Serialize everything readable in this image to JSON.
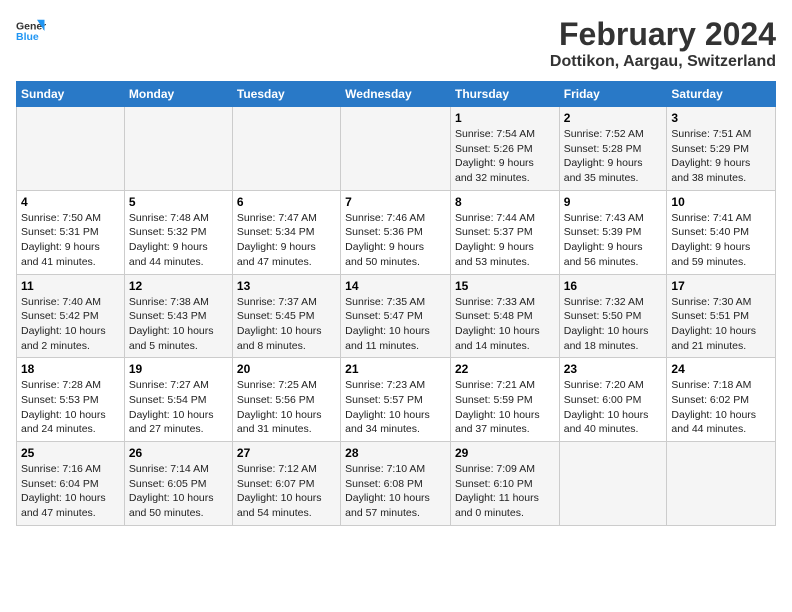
{
  "header": {
    "logo_line1": "General",
    "logo_line2": "Blue",
    "month": "February 2024",
    "location": "Dottikon, Aargau, Switzerland"
  },
  "columns": [
    "Sunday",
    "Monday",
    "Tuesday",
    "Wednesday",
    "Thursday",
    "Friday",
    "Saturday"
  ],
  "weeks": [
    [
      {
        "day": "",
        "info": ""
      },
      {
        "day": "",
        "info": ""
      },
      {
        "day": "",
        "info": ""
      },
      {
        "day": "",
        "info": ""
      },
      {
        "day": "1",
        "info": "Sunrise: 7:54 AM\nSunset: 5:26 PM\nDaylight: 9 hours\nand 32 minutes."
      },
      {
        "day": "2",
        "info": "Sunrise: 7:52 AM\nSunset: 5:28 PM\nDaylight: 9 hours\nand 35 minutes."
      },
      {
        "day": "3",
        "info": "Sunrise: 7:51 AM\nSunset: 5:29 PM\nDaylight: 9 hours\nand 38 minutes."
      }
    ],
    [
      {
        "day": "4",
        "info": "Sunrise: 7:50 AM\nSunset: 5:31 PM\nDaylight: 9 hours\nand 41 minutes."
      },
      {
        "day": "5",
        "info": "Sunrise: 7:48 AM\nSunset: 5:32 PM\nDaylight: 9 hours\nand 44 minutes."
      },
      {
        "day": "6",
        "info": "Sunrise: 7:47 AM\nSunset: 5:34 PM\nDaylight: 9 hours\nand 47 minutes."
      },
      {
        "day": "7",
        "info": "Sunrise: 7:46 AM\nSunset: 5:36 PM\nDaylight: 9 hours\nand 50 minutes."
      },
      {
        "day": "8",
        "info": "Sunrise: 7:44 AM\nSunset: 5:37 PM\nDaylight: 9 hours\nand 53 minutes."
      },
      {
        "day": "9",
        "info": "Sunrise: 7:43 AM\nSunset: 5:39 PM\nDaylight: 9 hours\nand 56 minutes."
      },
      {
        "day": "10",
        "info": "Sunrise: 7:41 AM\nSunset: 5:40 PM\nDaylight: 9 hours\nand 59 minutes."
      }
    ],
    [
      {
        "day": "11",
        "info": "Sunrise: 7:40 AM\nSunset: 5:42 PM\nDaylight: 10 hours\nand 2 minutes."
      },
      {
        "day": "12",
        "info": "Sunrise: 7:38 AM\nSunset: 5:43 PM\nDaylight: 10 hours\nand 5 minutes."
      },
      {
        "day": "13",
        "info": "Sunrise: 7:37 AM\nSunset: 5:45 PM\nDaylight: 10 hours\nand 8 minutes."
      },
      {
        "day": "14",
        "info": "Sunrise: 7:35 AM\nSunset: 5:47 PM\nDaylight: 10 hours\nand 11 minutes."
      },
      {
        "day": "15",
        "info": "Sunrise: 7:33 AM\nSunset: 5:48 PM\nDaylight: 10 hours\nand 14 minutes."
      },
      {
        "day": "16",
        "info": "Sunrise: 7:32 AM\nSunset: 5:50 PM\nDaylight: 10 hours\nand 18 minutes."
      },
      {
        "day": "17",
        "info": "Sunrise: 7:30 AM\nSunset: 5:51 PM\nDaylight: 10 hours\nand 21 minutes."
      }
    ],
    [
      {
        "day": "18",
        "info": "Sunrise: 7:28 AM\nSunset: 5:53 PM\nDaylight: 10 hours\nand 24 minutes."
      },
      {
        "day": "19",
        "info": "Sunrise: 7:27 AM\nSunset: 5:54 PM\nDaylight: 10 hours\nand 27 minutes."
      },
      {
        "day": "20",
        "info": "Sunrise: 7:25 AM\nSunset: 5:56 PM\nDaylight: 10 hours\nand 31 minutes."
      },
      {
        "day": "21",
        "info": "Sunrise: 7:23 AM\nSunset: 5:57 PM\nDaylight: 10 hours\nand 34 minutes."
      },
      {
        "day": "22",
        "info": "Sunrise: 7:21 AM\nSunset: 5:59 PM\nDaylight: 10 hours\nand 37 minutes."
      },
      {
        "day": "23",
        "info": "Sunrise: 7:20 AM\nSunset: 6:00 PM\nDaylight: 10 hours\nand 40 minutes."
      },
      {
        "day": "24",
        "info": "Sunrise: 7:18 AM\nSunset: 6:02 PM\nDaylight: 10 hours\nand 44 minutes."
      }
    ],
    [
      {
        "day": "25",
        "info": "Sunrise: 7:16 AM\nSunset: 6:04 PM\nDaylight: 10 hours\nand 47 minutes."
      },
      {
        "day": "26",
        "info": "Sunrise: 7:14 AM\nSunset: 6:05 PM\nDaylight: 10 hours\nand 50 minutes."
      },
      {
        "day": "27",
        "info": "Sunrise: 7:12 AM\nSunset: 6:07 PM\nDaylight: 10 hours\nand 54 minutes."
      },
      {
        "day": "28",
        "info": "Sunrise: 7:10 AM\nSunset: 6:08 PM\nDaylight: 10 hours\nand 57 minutes."
      },
      {
        "day": "29",
        "info": "Sunrise: 7:09 AM\nSunset: 6:10 PM\nDaylight: 11 hours\nand 0 minutes."
      },
      {
        "day": "",
        "info": ""
      },
      {
        "day": "",
        "info": ""
      }
    ]
  ]
}
